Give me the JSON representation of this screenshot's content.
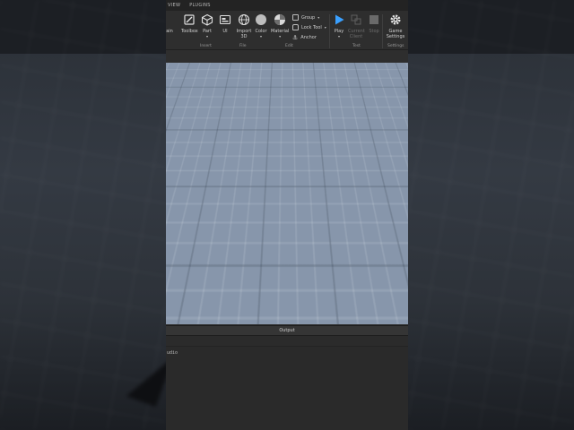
{
  "menu": {
    "items": [
      "VIEW",
      "PLUGINS"
    ]
  },
  "ribbon": {
    "partial_left_label": "rain",
    "tools": {
      "toolbox": "Toolbox",
      "part": "Part",
      "ui": "UI",
      "import3d": "Import 3D",
      "color": "Color",
      "material": "Material",
      "play": "Play",
      "current_client": "Current Client",
      "stop": "Stop",
      "game_settings": "Game Settings"
    },
    "mini": {
      "group": "Group",
      "lock_tool": "Lock Tool",
      "anchor": "Anchor"
    },
    "sections": {
      "insert": "Insert",
      "file": "File",
      "edit": "Edit",
      "test": "Test",
      "settings": "Settings"
    }
  },
  "output": {
    "title": "Output",
    "line": "udio"
  },
  "colors": {
    "selection": "#2f7fe6",
    "play": "#3aa0ff",
    "panel": "#2e2e2e",
    "floor": "#8796ab"
  }
}
